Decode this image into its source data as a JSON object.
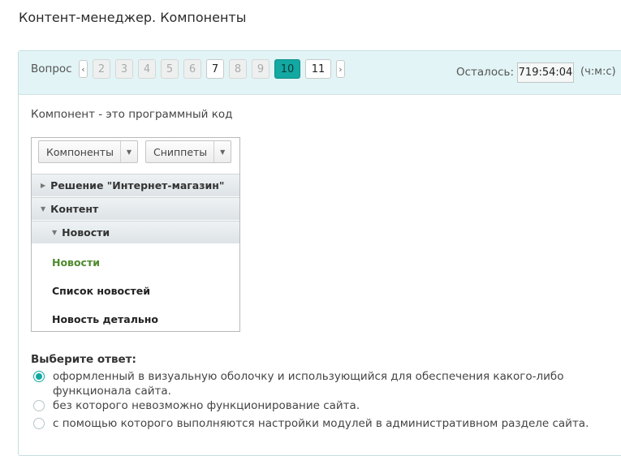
{
  "page": {
    "title": "Контент-менеджер. Компоненты"
  },
  "header": {
    "question_label": "Вопрос",
    "prev_arrow": "‹",
    "next_arrow": "›",
    "pages": [
      "2",
      "3",
      "4",
      "5",
      "6",
      "7",
      "8",
      "9",
      "10",
      "11"
    ],
    "active_page": "10",
    "timer_label": "Осталось:",
    "timer_value": "719:54:04",
    "timer_unit": "(ч:м:с)"
  },
  "question": {
    "text": "Компонент - это программный код"
  },
  "widget": {
    "tabs": [
      {
        "label": "Компоненты",
        "caret": "▼"
      },
      {
        "label": "Сниппеты",
        "caret": "▼"
      }
    ],
    "tree": [
      {
        "label": "Решение \"Интернет-магазин\"",
        "arrow": "▶"
      },
      {
        "label": "Контент",
        "arrow": "▼"
      },
      {
        "label": "Новости",
        "arrow": "▼"
      }
    ],
    "items": [
      "Новости",
      "Список новостей",
      "Новость детально"
    ]
  },
  "answers": {
    "title": "Выберите ответ:",
    "options": [
      {
        "text": "оформленный в визуальную оболочку и использующийся для обеспечения какого-либо функционала сайта.",
        "checked": true
      },
      {
        "text": "без которого невозможно функционирование сайта.",
        "checked": false
      },
      {
        "text": "с помощью которого выполняются настройки модулей в административном разделе сайта.",
        "checked": false
      }
    ]
  },
  "colors": {
    "accent": "#13a8a2",
    "header_bg": "#e2f4f5",
    "active_item": "#4f8a2e"
  }
}
